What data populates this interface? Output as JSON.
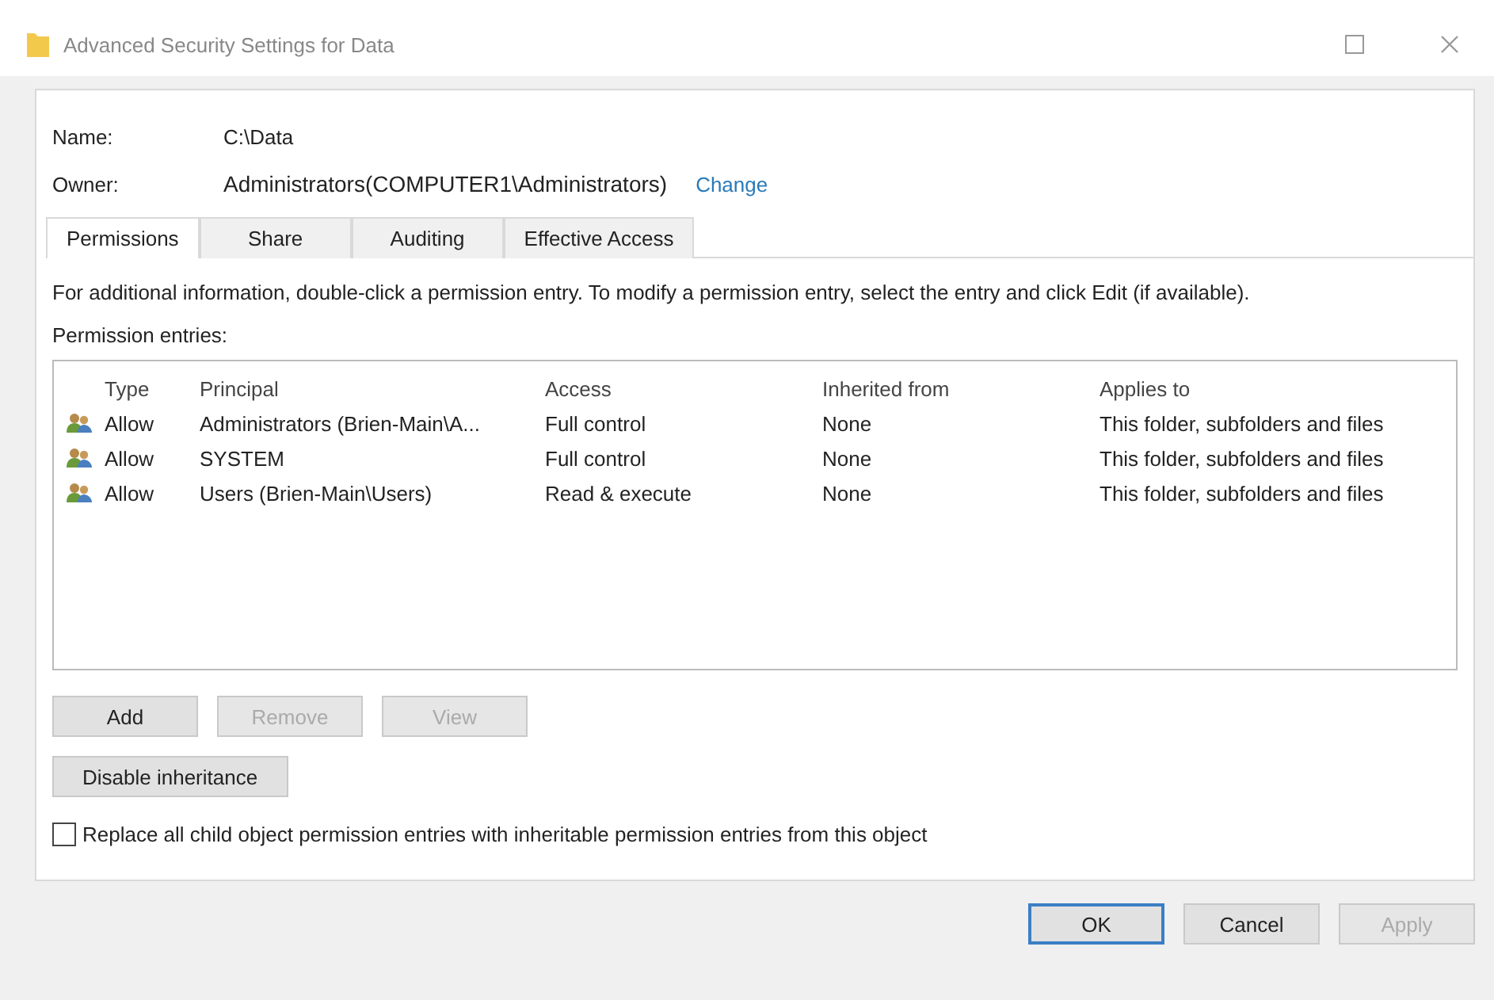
{
  "window": {
    "title": "Advanced Security Settings for Data"
  },
  "name": {
    "label": "Name:",
    "value": "C:\\Data"
  },
  "owner": {
    "label": "Owner:",
    "value": "Administrators(COMPUTER1\\Administrators)",
    "link": "Change"
  },
  "tabs": [
    {
      "label": "Permissions",
      "selected": true
    },
    {
      "label": "Share",
      "selected": false
    },
    {
      "label": "Auditing",
      "selected": false
    },
    {
      "label": "Effective Access",
      "selected": false
    }
  ],
  "info": "For additional information, double-click a permission entry. To modify a permission entry, select the entry and click Edit (if available).",
  "entries_label": "Permission entries:",
  "table": {
    "columns": [
      "Type",
      "Principal",
      "Access",
      "Inherited from",
      "Applies to"
    ],
    "rows": [
      {
        "cells": [
          "Allow",
          "Administrators (Brien-Main\\A...",
          "Full control",
          "None",
          "This folder, subfolders and files"
        ]
      },
      {
        "cells": [
          "Allow",
          "SYSTEM",
          "Full control",
          "None",
          "This folder, subfolders and files"
        ]
      },
      {
        "cells": [
          "Allow",
          "Users (Brien-Main\\Users)",
          "Read & execute",
          "None",
          "This folder, subfolders and files"
        ]
      }
    ]
  },
  "entry_buttons": [
    {
      "label": "Add",
      "disabled": false
    },
    {
      "label": "Remove",
      "disabled": true
    },
    {
      "label": "View",
      "disabled": true
    }
  ],
  "inheritance_button": "Disable inheritance",
  "replace_checkbox": {
    "label": "Replace all child object permission entries with inheritable permission entries from this object",
    "checked": false
  },
  "dialog_buttons": [
    {
      "label": "OK",
      "disabled": false,
      "default": true
    },
    {
      "label": "Cancel",
      "disabled": false,
      "default": false
    },
    {
      "label": "Apply",
      "disabled": true,
      "default": false
    }
  ]
}
